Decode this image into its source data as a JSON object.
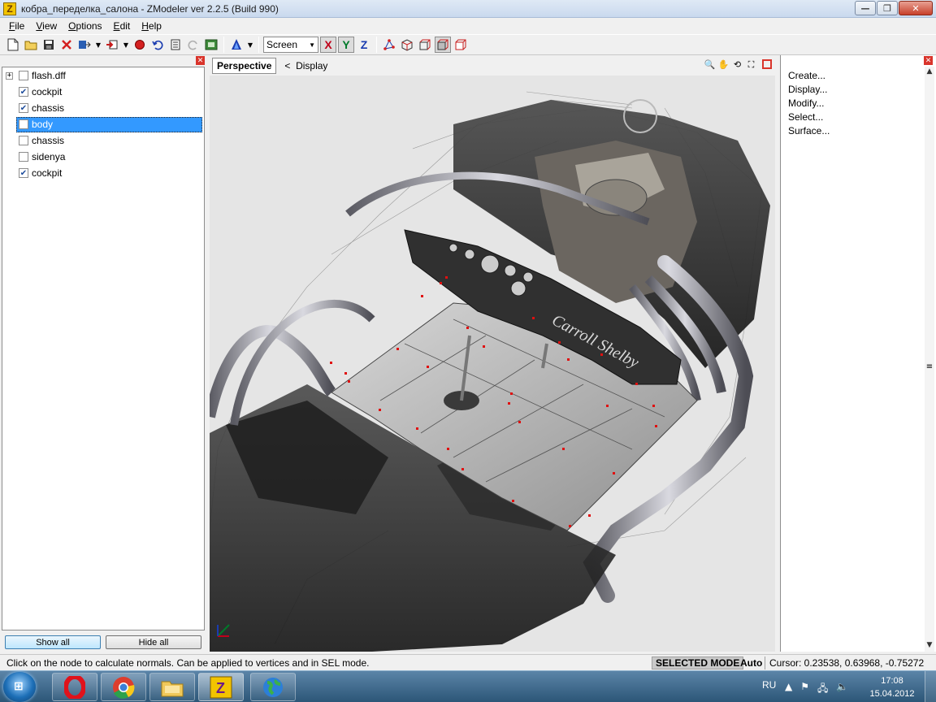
{
  "window": {
    "title": "кобра_переделка_салона - ZModeler ver 2.2.5 (Build 990)",
    "app_icon": "Z",
    "minimize": "—",
    "maximize": "❐",
    "close": "✕"
  },
  "menu": [
    {
      "label": "File",
      "mnemonic": "F",
      "rest": "ile"
    },
    {
      "label": "View",
      "mnemonic": "V",
      "rest": "iew"
    },
    {
      "label": "Options",
      "mnemonic": "O",
      "rest": "ptions"
    },
    {
      "label": "Edit",
      "mnemonic": "E",
      "rest": "dit"
    },
    {
      "label": "Help",
      "mnemonic": "H",
      "rest": "elp"
    }
  ],
  "toolbar": {
    "view_mode": "Screen",
    "axes": [
      "X",
      "Y",
      "Z"
    ],
    "axis_colors": {
      "X": "#c0001a",
      "Y": "#007a2a",
      "Z": "#1a3cb0"
    }
  },
  "tree": {
    "nodes": [
      {
        "label": "flash.dff",
        "checked": false,
        "expander": "+"
      },
      {
        "label": "cockpit",
        "checked": true
      },
      {
        "label": "chassis",
        "checked": true
      },
      {
        "label": "body",
        "checked": false,
        "selected": true
      },
      {
        "label": "chassis",
        "checked": false
      },
      {
        "label": "sidenya",
        "checked": false
      },
      {
        "label": "cockpit",
        "checked": true
      }
    ],
    "show_all": "Show all",
    "hide_all": "Hide all"
  },
  "viewport": {
    "tab": "Perspective",
    "breadcrumb_arrow": "<",
    "breadcrumb": "Display"
  },
  "commands": [
    "Create...",
    "Display...",
    "Modify...",
    "Select...",
    "Surface..."
  ],
  "status": {
    "message": "Click on the node to calculate normals. Can be applied to vertices and in SEL mode.",
    "mode": "SELECTED MODE",
    "auto": "Auto",
    "cursor": "Cursor: 0.23538, 0.63968, -0.75272"
  },
  "taskbar": {
    "language": "RU",
    "time": "17:08",
    "date": "15.04.2012"
  }
}
